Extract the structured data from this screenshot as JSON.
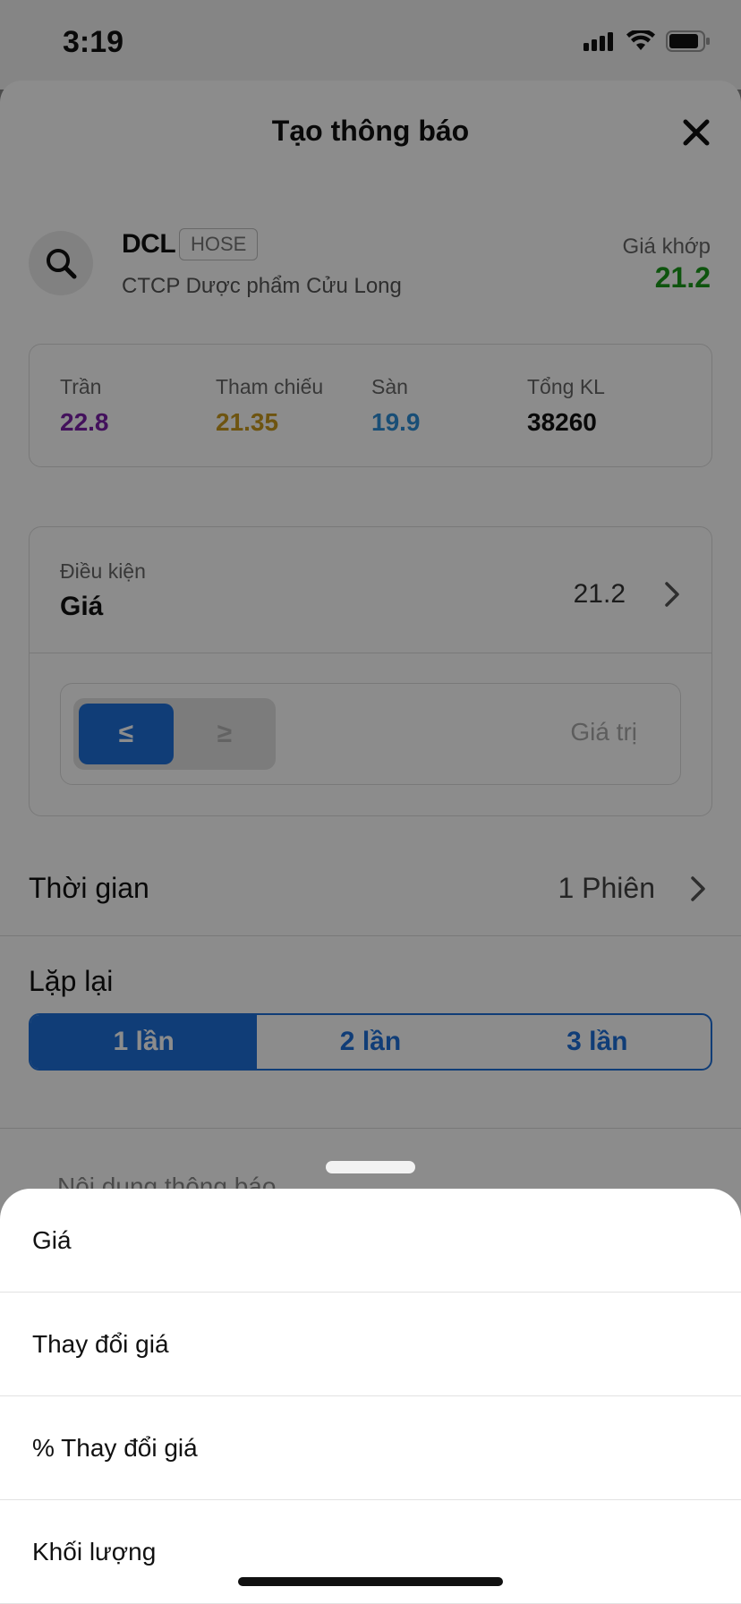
{
  "status_bar": {
    "time": "3:19"
  },
  "header": {
    "title": "Tạo thông báo"
  },
  "stock": {
    "symbol": "DCL",
    "exchange": "HOSE",
    "company": "CTCP Dược phẩm Cửu Long",
    "match_label": "Giá khớp",
    "match_value": "21.2"
  },
  "price_info": {
    "ceiling_label": "Trần",
    "ceiling": "22.8",
    "ceiling_color": "#7a1fa8",
    "reference_label": "Tham chiếu",
    "reference": "21.35",
    "reference_color": "#c99a1e",
    "floor_label": "Sàn",
    "floor": "19.9",
    "floor_color": "#2f8fd8",
    "volume_label": "Tổng KL",
    "volume": "38260"
  },
  "condition": {
    "label": "Điều kiện",
    "value": "Giá",
    "current": "21.2",
    "le_symbol": "≤",
    "ge_symbol": "≥",
    "value_placeholder": "Giá trị"
  },
  "time": {
    "label": "Thời gian",
    "value": "1 Phiên"
  },
  "repeat": {
    "label": "Lặp lại",
    "options": [
      "1 lần",
      "2 lần",
      "3 lần"
    ],
    "selected": "1 lần"
  },
  "content": {
    "label": "Nội dung thông báo"
  },
  "action_sheet": {
    "items": [
      "Giá",
      "Thay đổi giá",
      "% Thay đổi giá",
      "Khối lượng"
    ]
  },
  "colors": {
    "accent": "#1e6fd9",
    "match_green": "#1a9a1a"
  }
}
